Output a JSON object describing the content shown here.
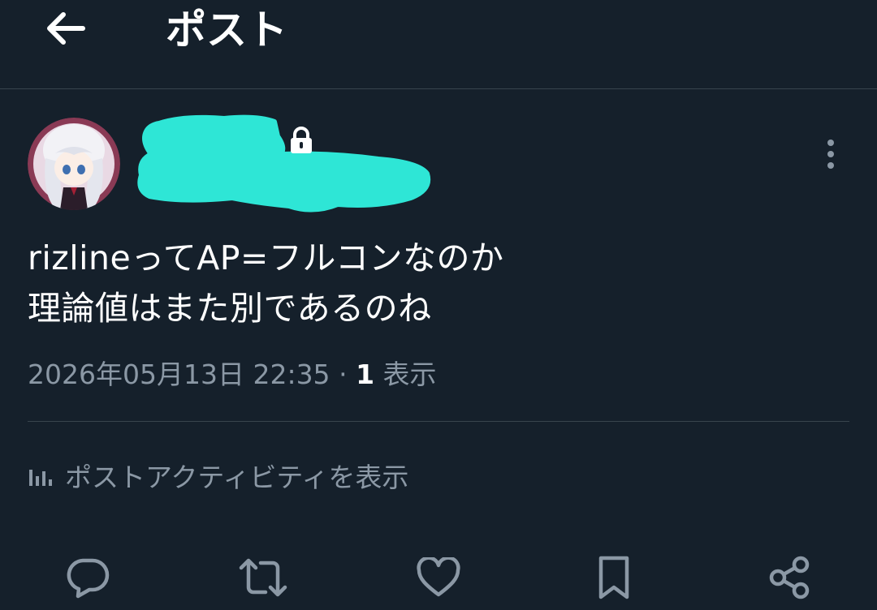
{
  "header": {
    "title": "ポスト",
    "back_icon": "arrow-left-icon"
  },
  "post": {
    "avatar_icon": "avatar",
    "lock_icon": "lock-icon",
    "more_icon": "more-vertical-icon",
    "text_lines": [
      "rizlineってAP=フルコンなのか",
      "理論値はまた別であるのね"
    ],
    "timestamp": "2026年05月13日 22:35",
    "separator": "·",
    "views_count": "1",
    "views_label": "表示"
  },
  "activity": {
    "icon": "analytics-icon",
    "label": "ポストアクティビティを表示"
  },
  "actions": [
    {
      "icon": "reply-icon"
    },
    {
      "icon": "repost-icon"
    },
    {
      "icon": "like-icon"
    },
    {
      "icon": "bookmark-icon"
    },
    {
      "icon": "share-icon"
    }
  ],
  "colors": {
    "background": "#15202b",
    "divider": "#38444d",
    "secondary_text": "#8b98a5",
    "redaction": "#2ee6d6"
  }
}
